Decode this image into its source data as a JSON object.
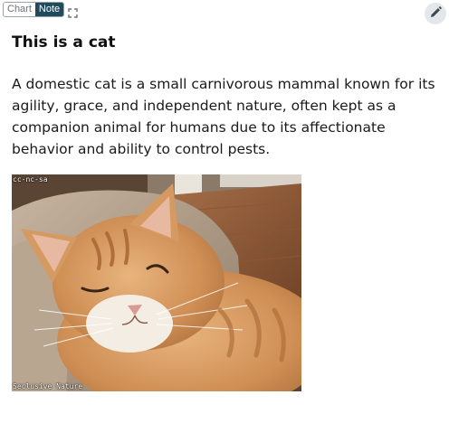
{
  "toolbar": {
    "tabs": [
      {
        "label": "Chart",
        "active": false
      },
      {
        "label": "Note",
        "active": true
      }
    ],
    "expand_icon": "expand-icon"
  },
  "edit_button": {
    "icon": "pencil-icon"
  },
  "note": {
    "title": "This is a cat",
    "body": "A domestic cat is a small carnivorous mammal known for its agility, grace, and independent nature, often kept as a companion animal for humans due to its affectionate behavior and ability to control pests."
  },
  "image": {
    "license": "cc-nc-sa",
    "credit": "Seclusive Nature"
  },
  "colors": {
    "active_tab": "#1f4b5c",
    "edit_button_bg": "#e4e7ea"
  }
}
